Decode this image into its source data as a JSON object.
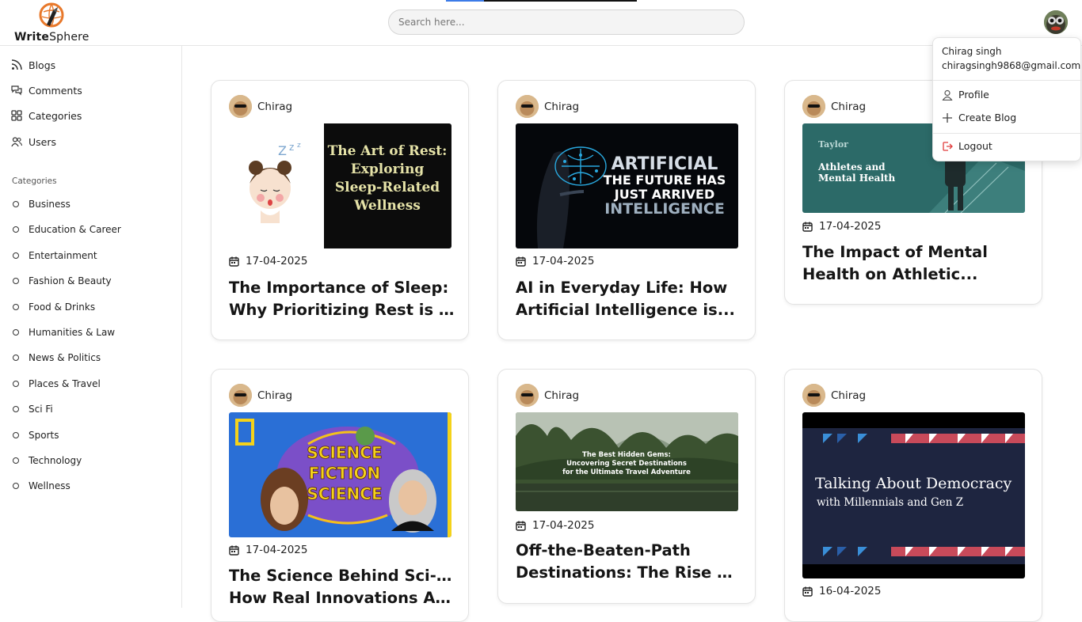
{
  "app": {
    "logo_bold": "Write",
    "logo_rest": "Sphere"
  },
  "search": {
    "placeholder": "Search here..."
  },
  "sidebar": {
    "nav": [
      {
        "label": "Blogs",
        "icon": "rss-icon"
      },
      {
        "label": "Comments",
        "icon": "comments-icon"
      },
      {
        "label": "Categories",
        "icon": "grid-icon"
      },
      {
        "label": "Users",
        "icon": "users-icon"
      }
    ],
    "categories_heading": "Categories",
    "categories": [
      "Business",
      "Education & Career",
      "Entertainment",
      "Fashion & Beauty",
      "Food & Drinks",
      "Humanities & Law",
      "News & Politics",
      "Places & Travel",
      "Sci Fi",
      "Sports",
      "Technology",
      "Wellness"
    ]
  },
  "posts": [
    {
      "author": "Chirag",
      "date": "17-04-2025",
      "title_line1": "The Importance of Sleep:",
      "title_line2": "Why Prioritizing Rest is K...",
      "image_text": [
        "The Art of Rest:",
        "Exploring",
        "Sleep-Related",
        "Wellness"
      ]
    },
    {
      "author": "Chirag",
      "date": "17-04-2025",
      "title_line1": "AI in Everyday Life: How",
      "title_line2": "Artificial Intelligence is...",
      "image_text": [
        "ARTIFICIAL",
        "THE FUTURE HAS",
        "JUST ARRIVED",
        "INTELLIGENCE"
      ]
    },
    {
      "author": "Chirag",
      "date": "17-04-2025",
      "title_line1": "The Impact of Mental",
      "title_line2": "Health on Athletic...",
      "image_text": [
        "Taylor",
        "Athletes and",
        "Mental Health"
      ]
    },
    {
      "author": "Chirag",
      "date": "17-04-2025",
      "title_line1": "The Science Behind Sci-Fi:",
      "title_line2": "How Real Innovations Are...",
      "image_text": [
        "SCIENCE",
        "FICTION",
        "SCIENCE"
      ]
    },
    {
      "author": "Chirag",
      "date": "17-04-2025",
      "title_line1": "Off-the-Beaten-Path",
      "title_line2": "Destinations: The Rise of...",
      "image_text": [
        "The Best Hidden Gems:",
        "Uncovering Secret Destinations",
        "for the Ultimate Travel Adventure"
      ]
    },
    {
      "author": "Chirag",
      "date": "16-04-2025",
      "title_line1": "",
      "title_line2": "",
      "image_text": [
        "Talking About Democracy",
        "with Millennials and Gen Z"
      ]
    }
  ],
  "user_menu": {
    "name": "Chirag singh",
    "email": "chiragsingh9868@gmail.com",
    "items": [
      {
        "label": "Profile",
        "icon": "user-icon"
      },
      {
        "label": "Create Blog",
        "icon": "plus-icon"
      },
      {
        "label": "Logout",
        "icon": "logout-icon"
      }
    ]
  },
  "colors": {
    "accent": "#3c7be8",
    "logo_orange": "#e8782a",
    "logout_red": "#e03c3c"
  }
}
